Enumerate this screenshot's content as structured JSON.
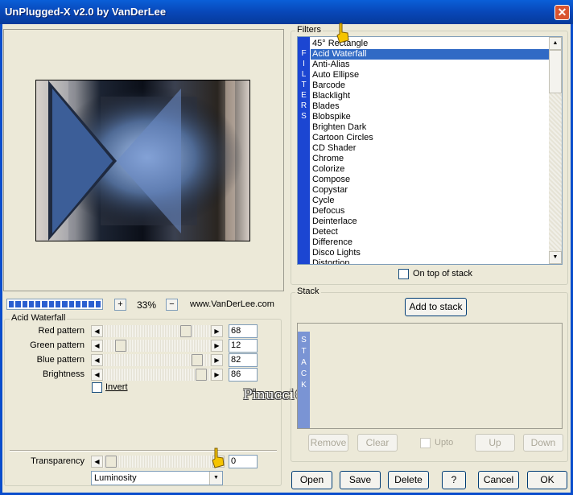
{
  "window": {
    "title": "UnPlugged-X v2.0 by VanDerLee",
    "close_glyph": "✕"
  },
  "preview": {
    "zoom": "33%",
    "zoom_in": "+",
    "zoom_out": "−",
    "url": "www.VanDerLee.com",
    "progress_blocks": 14
  },
  "filters": {
    "label": "Filters",
    "strip_letters": [
      "F",
      "I",
      "L",
      "T",
      "E",
      "R",
      "S"
    ],
    "selected": "Acid Waterfall",
    "items": [
      "45° Rectangle",
      "Acid Waterfall",
      "Anti-Alias",
      "Auto Ellipse",
      "Barcode",
      "Blacklight",
      "Blades",
      "Blobspike",
      "Brighten Dark",
      "Cartoon Circles",
      "CD Shader",
      "Chrome",
      "Colorize",
      "Compose",
      "Copystar",
      "Cycle",
      "Defocus",
      "Deinterlace",
      "Detect",
      "Difference",
      "Disco Lights",
      "Distortion"
    ],
    "on_top_of_stack": "On top of stack"
  },
  "stack": {
    "label": "Stack",
    "add_button": "Add to stack",
    "strip_letters": [
      "S",
      "T",
      "A",
      "C",
      "K"
    ],
    "remove": "Remove",
    "clear": "Clear",
    "upto": "Upto",
    "up": "Up",
    "down": "Down"
  },
  "params": {
    "group_label": "Acid Waterfall",
    "sliders": [
      {
        "label": "Red pattern",
        "value": "68"
      },
      {
        "label": "Green pattern",
        "value": "12"
      },
      {
        "label": "Blue pattern",
        "value": "82"
      },
      {
        "label": "Brightness",
        "value": "86"
      }
    ],
    "invert": "Invert",
    "transparency_label": "Transparency",
    "transparency_value": "0",
    "blend_mode": "Luminosity"
  },
  "watermark": "Pinucci©",
  "buttons": {
    "open": "Open",
    "save": "Save",
    "delete": "Delete",
    "help": "?",
    "cancel": "Cancel",
    "ok": "OK"
  },
  "colors": {
    "titlebar": "#0847b8",
    "selection": "#316ac5",
    "filter_strip": "#1c46d2",
    "stack_strip": "#7a94d4",
    "pointer_hand": "#f5c400"
  }
}
